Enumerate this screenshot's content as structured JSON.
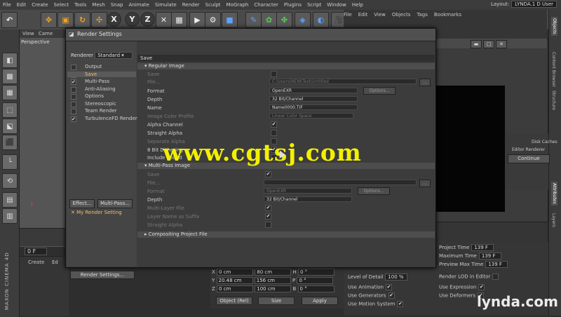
{
  "menubar": {
    "items": [
      "File",
      "Edit",
      "Create",
      "Select",
      "Tools",
      "Mesh",
      "Snap",
      "Animate",
      "Simulate",
      "Render",
      "Sculpt",
      "MoGraph",
      "Character",
      "Plugins",
      "Script",
      "Window",
      "Help"
    ],
    "layout_label": "Layout:",
    "layout_value": "LYNDA.1 D User"
  },
  "toolbar": {
    "tools": [
      {
        "icon": "undo-icon",
        "glyph": "↶"
      },
      {
        "icon": "move-icon",
        "glyph": "✥"
      },
      {
        "icon": "scale-icon",
        "glyph": "▣"
      },
      {
        "icon": "rotate-icon",
        "glyph": "↻"
      },
      {
        "icon": "pointer-icon",
        "glyph": "✣"
      },
      {
        "icon": "x-axis-icon",
        "glyph": "X"
      },
      {
        "icon": "y-axis-icon",
        "glyph": "Y"
      },
      {
        "icon": "z-axis-icon",
        "glyph": "Z"
      },
      {
        "icon": "world-coord-icon",
        "glyph": "✕"
      },
      {
        "icon": "clapper-icon",
        "glyph": "▦"
      },
      {
        "icon": "render-view-icon",
        "glyph": "▶"
      },
      {
        "icon": "render-settings-icon",
        "glyph": "⚙"
      },
      {
        "icon": "cube-icon",
        "glyph": "■"
      },
      {
        "icon": "pen-icon",
        "glyph": "✎"
      },
      {
        "icon": "subdivision-icon",
        "glyph": "✿"
      },
      {
        "icon": "array-icon",
        "glyph": "✤"
      },
      {
        "icon": "deformer-icon",
        "glyph": "◈"
      },
      {
        "icon": "scene-icon",
        "glyph": "◐"
      },
      {
        "icon": "camera-icon",
        "glyph": "🎥"
      },
      {
        "icon": "light-icon",
        "glyph": "☀"
      }
    ]
  },
  "viewport": {
    "menu": [
      "View",
      "Came"
    ],
    "label": "Perspective"
  },
  "object_manager": {
    "menu": [
      "File",
      "Edit",
      "View",
      "Objects",
      "Tags",
      "Bookmarks"
    ]
  },
  "right_tabs": [
    "Objects",
    "Content Browser",
    "Structure",
    "Attributes",
    "Layers"
  ],
  "attributes": {
    "disk_cache": "Disk Caches",
    "editor_renderer": "Editor Renderer",
    "continue": "Continue"
  },
  "project_props": {
    "project_time_label": "Project Time",
    "project_time": "139 F",
    "maximum_time_label": "Maximum Time",
    "maximum_time": "139 F",
    "preview_max_label": "Preview Max Time",
    "preview_max": "139 F",
    "lod_label": "Level of Detail",
    "lod": "100 %",
    "render_lod_label": "Render LOD in Editor",
    "use_animation": "Use Animation",
    "use_expression": "Use Expression",
    "use_generators": "Use Generators",
    "use_deformers": "Use Deformers",
    "use_motion_system": "Use Motion System"
  },
  "coordinates": {
    "rows": [
      {
        "axis": "X",
        "pos": "0 cm",
        "size": "80 cm",
        "rot_axis": "H",
        "rot": "0 °"
      },
      {
        "axis": "Y",
        "pos": "20.48 cm",
        "size": "156 cm",
        "rot_axis": "P",
        "rot": "0 °"
      },
      {
        "axis": "Z",
        "pos": "0 cm",
        "size": "100 cm",
        "rot_axis": "B",
        "rot": "0 °"
      }
    ],
    "mode": "Object (Rel)",
    "size_mode": "Size",
    "apply": "Apply"
  },
  "material": {
    "menu": [
      "Create",
      "Ed"
    ]
  },
  "timeline": {
    "frame": "0 F"
  },
  "dialog": {
    "title": "Render Settings",
    "renderer_label": "Renderer",
    "renderer_value": "Standard",
    "tree": [
      {
        "label": "Output",
        "check": ""
      },
      {
        "label": "Save",
        "check": "",
        "selected": true
      },
      {
        "label": "Multi-Pass",
        "check": "✔"
      },
      {
        "label": "Anti-Aliasing",
        "check": ""
      },
      {
        "label": "Options",
        "check": ""
      },
      {
        "label": "Stereoscopic",
        "check": ""
      },
      {
        "label": "Team Render",
        "check": ""
      },
      {
        "label": "TurbulenceFD Render",
        "check": "✔"
      }
    ],
    "effect_btn": "Effect...",
    "multipass_btn": "Multi-Pass...",
    "my_render_setting": "My Render Setting",
    "render_settings_btn": "Render Settings...",
    "path": "Save",
    "regular_image": "Regular Image",
    "fields": {
      "save": "Save",
      "file": "File...",
      "file_value": "C:\\Users\\NEW\\Test\\Untitled",
      "format": "Format",
      "format_value": "OpenEXR",
      "options_btn": "Options...",
      "depth": "Depth",
      "depth_value": "32 Bit/Channel",
      "name": "Name",
      "name_value": "Name0000.TIF",
      "image_color_profile": "Image Color Profile",
      "profile_value": "Linear Color Space",
      "alpha_channel": "Alpha Channel",
      "straight_alpha": "Straight Alpha",
      "separate_alpha": "Separate Alpha",
      "dithering": "8 Bit Dithering",
      "include_sound": "Include Sound"
    },
    "multipass_image": "Multi-Pass Image",
    "mp_fields": {
      "save": "Save",
      "file": "File...",
      "format": "Format",
      "format_value": "OpenEXR",
      "options_btn": "Options...",
      "depth": "Depth",
      "depth_value": "32 Bit/Channel",
      "multi_layer": "Multi-Layer File",
      "layer_name": "Layer Name as Suffix",
      "straight_alpha": "Straight Alpha"
    },
    "compositing": "Compositing Project File"
  },
  "watermark": "www.cgtsj.com",
  "brand": {
    "maxon": "MAXON CINEMA 4D",
    "lynda": "lynda.com"
  }
}
